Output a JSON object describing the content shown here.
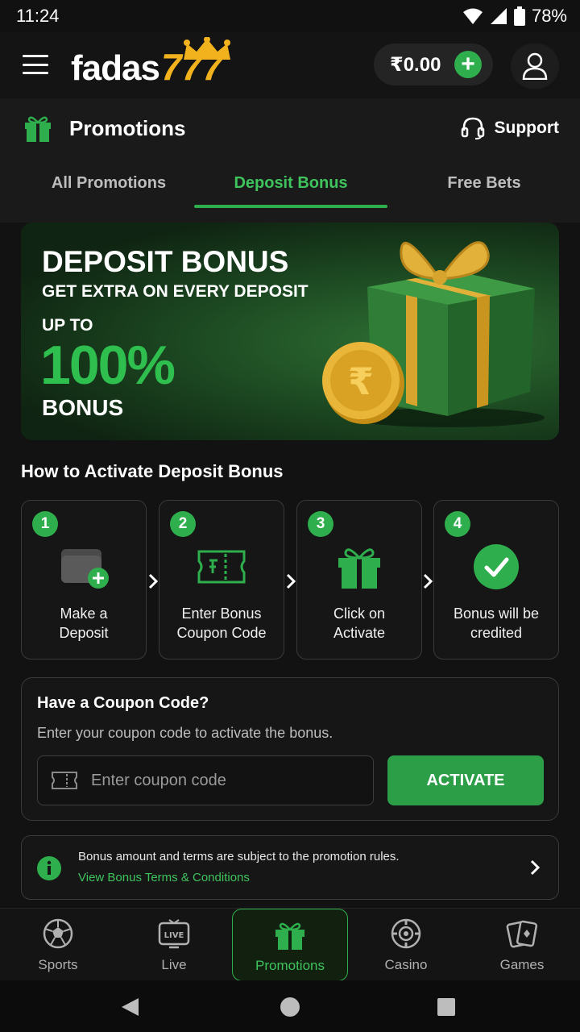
{
  "status_bar": {
    "time": "11:24",
    "battery": "78%"
  },
  "header": {
    "logo_word": "fadas",
    "logo_number": "777",
    "balance": "₹0.00"
  },
  "page": {
    "title": "Promotions",
    "support_label": "Support",
    "tabs": [
      {
        "label": "All Promotions",
        "active": false
      },
      {
        "label": "Deposit Bonus",
        "active": true
      },
      {
        "label": "Free Bets",
        "active": false
      }
    ]
  },
  "banner": {
    "title": "DEPOSIT BONUS",
    "subtitle": "GET EXTRA ON EVERY DEPOSIT",
    "upto": "UP TO",
    "percent": "100%",
    "bonus": "BONUS"
  },
  "howto": {
    "title": "How to Activate Deposit Bonus",
    "steps": [
      {
        "number": "1",
        "line1": "Make a",
        "line2": "Deposit",
        "icon": "wallet-plus-icon"
      },
      {
        "number": "2",
        "line1": "Enter Bonus",
        "line2": "Coupon Code",
        "icon": "ticket-icon"
      },
      {
        "number": "3",
        "line1": "Click on",
        "line2": "Activate",
        "icon": "gift-icon"
      },
      {
        "number": "4",
        "line1": "Bonus will be",
        "line2": "credited",
        "icon": "check-circle-icon"
      }
    ]
  },
  "coupon": {
    "title": "Have a Coupon Code?",
    "subtitle": "Enter your coupon code to activate the bonus.",
    "placeholder": "Enter coupon code",
    "button": "ACTIVATE"
  },
  "info": {
    "text": "Bonus amount and terms are subject to the promotion rules.",
    "link": "View Bonus Terms & Conditions"
  },
  "bottom_nav": [
    {
      "label": "Sports",
      "icon": "soccer-ball-icon",
      "active": false
    },
    {
      "label": "Live",
      "icon": "live-tv-icon",
      "active": false
    },
    {
      "label": "Promotions",
      "icon": "gift-icon",
      "active": true
    },
    {
      "label": "Casino",
      "icon": "casino-chip-icon",
      "active": false
    },
    {
      "label": "Games",
      "icon": "cards-icon",
      "active": false
    }
  ],
  "colors": {
    "accent": "#2fae4d",
    "gold": "#f2b21d",
    "background": "#121212"
  }
}
